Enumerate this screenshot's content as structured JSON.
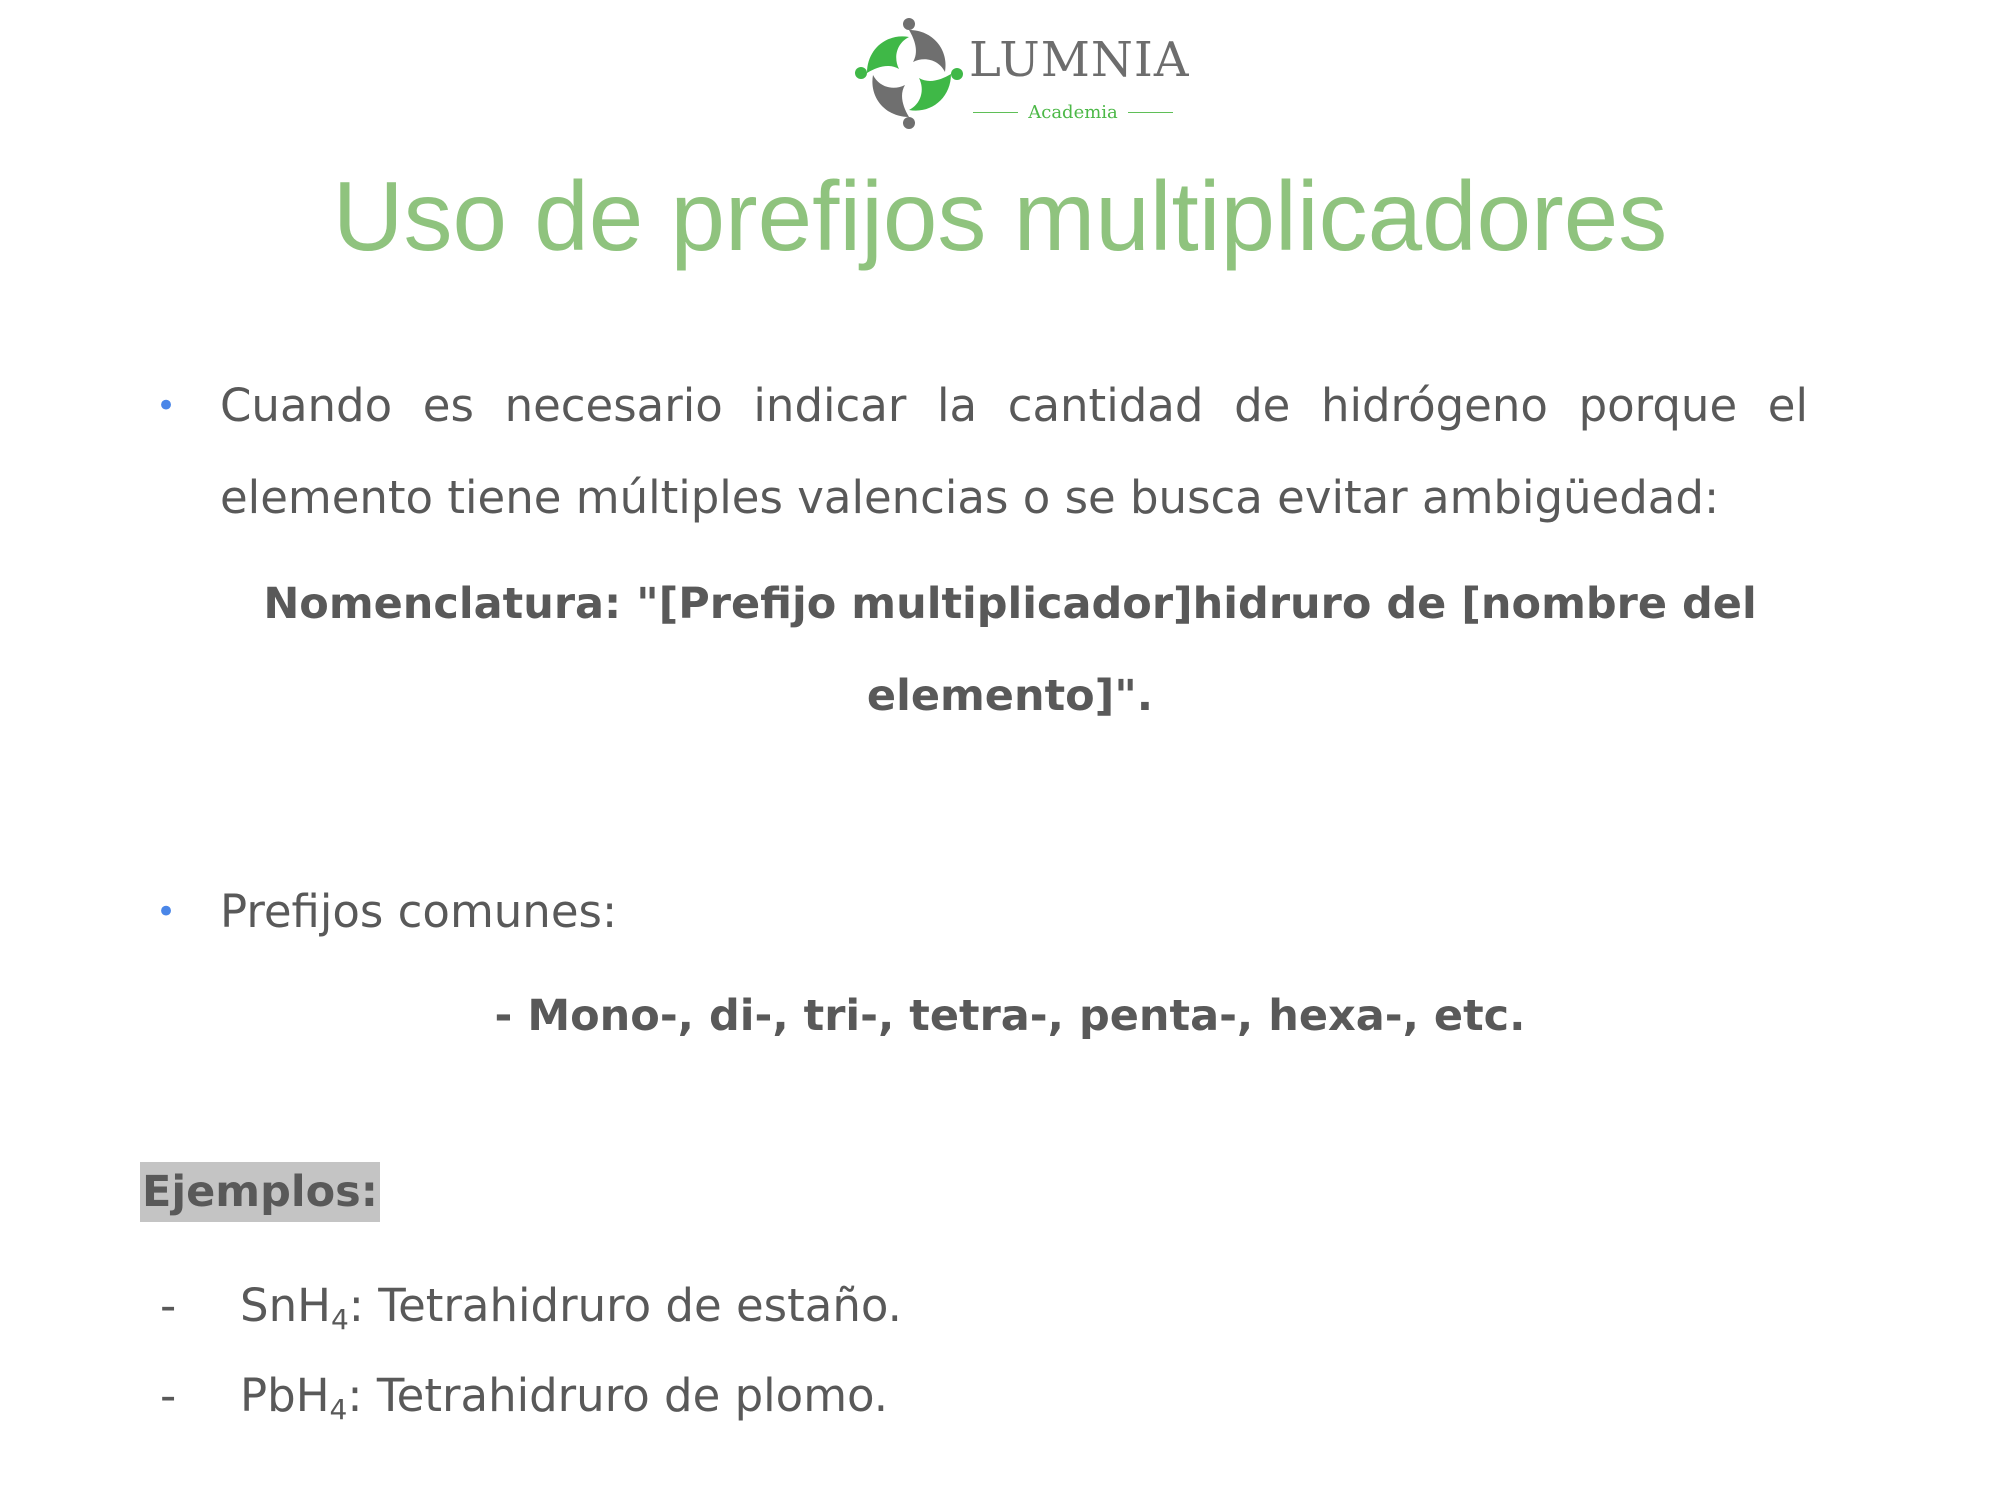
{
  "logo": {
    "name": "LUMNIA",
    "subtitle": "Academia"
  },
  "title": "Uso de prefijos multiplicadores",
  "bullets": [
    {
      "text": "Cuando es necesario indicar la cantidad de hidrógeno porque el elemento tiene múltiples valencias o se busca evitar ambigüedad:"
    },
    {
      "text": "Prefijos comunes:"
    }
  ],
  "nomenclature": "Nomenclatura: \"[Prefijo multiplicador]hidruro de [nombre del elemento]\".",
  "prefixes_line": "- Mono-, di-, tri-, tetra-, penta-, hexa-, etc.",
  "examples": {
    "heading": "Ejemplos:",
    "items": [
      {
        "dash": "-",
        "formula_base": "SnH",
        "formula_sub": "4",
        "description": ": Tetrahidruro de estaño."
      },
      {
        "dash": "-",
        "formula_base": "PbH",
        "formula_sub": "4",
        "description": ": Tetrahidruro de plomo."
      }
    ]
  },
  "colors": {
    "title": "#8fc37e",
    "body_text": "#595959",
    "bullet": "#4a86e8",
    "logo_green": "#4cb847",
    "logo_gray": "#6d6d6d",
    "highlight": "#c4c4c4"
  }
}
